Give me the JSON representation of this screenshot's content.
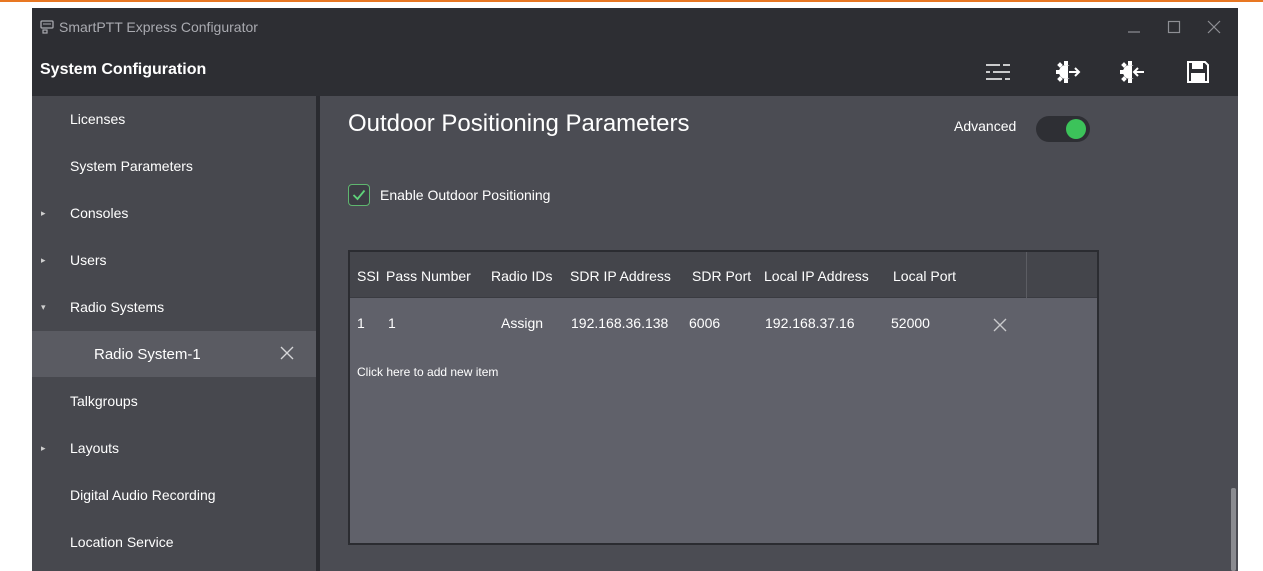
{
  "app": {
    "title": "SmartPTT Express Configurator",
    "accent_color": "#e87722"
  },
  "toolbar": {
    "title": "System Configuration",
    "buttons": [
      {
        "name": "settings-sliders-icon"
      },
      {
        "name": "export-icon"
      },
      {
        "name": "import-icon"
      },
      {
        "name": "save-icon"
      }
    ]
  },
  "sidebar": {
    "items": [
      {
        "label": "Licenses",
        "arrow": ""
      },
      {
        "label": "System Parameters",
        "arrow": ""
      },
      {
        "label": "Consoles",
        "arrow": "▸"
      },
      {
        "label": "Users",
        "arrow": "▸"
      },
      {
        "label": "Radio Systems",
        "arrow": "▾"
      },
      {
        "label": "Radio System-1",
        "arrow": ""
      },
      {
        "label": "Talkgroups",
        "arrow": ""
      },
      {
        "label": "Layouts",
        "arrow": "▸"
      },
      {
        "label": "Digital Audio Recording",
        "arrow": ""
      },
      {
        "label": "Location Service",
        "arrow": ""
      }
    ]
  },
  "main": {
    "title": "Outdoor Positioning Parameters",
    "advanced_label": "Advanced",
    "advanced_on": true,
    "enable_label": "Enable Outdoor Positioning",
    "enable_checked": true,
    "table": {
      "columns": [
        "SSI",
        "Pass Number",
        "Radio IDs",
        "SDR IP Address",
        "SDR Port",
        "Local IP Address",
        "Local Port"
      ],
      "rows": [
        [
          "1",
          "1",
          "Assign",
          "192.168.36.138",
          "6006",
          "192.168.37.16",
          "52000"
        ]
      ],
      "add_new_label": "Click here to add new item"
    }
  },
  "colors": {
    "window_bg": "#3c3d44",
    "titlebar_bg": "#2d2e33",
    "sidebar_bg": "#47484e",
    "content_bg": "#4b4c53",
    "toggle_on": "#3cc35a",
    "checkbox_border": "#5fb66f"
  }
}
